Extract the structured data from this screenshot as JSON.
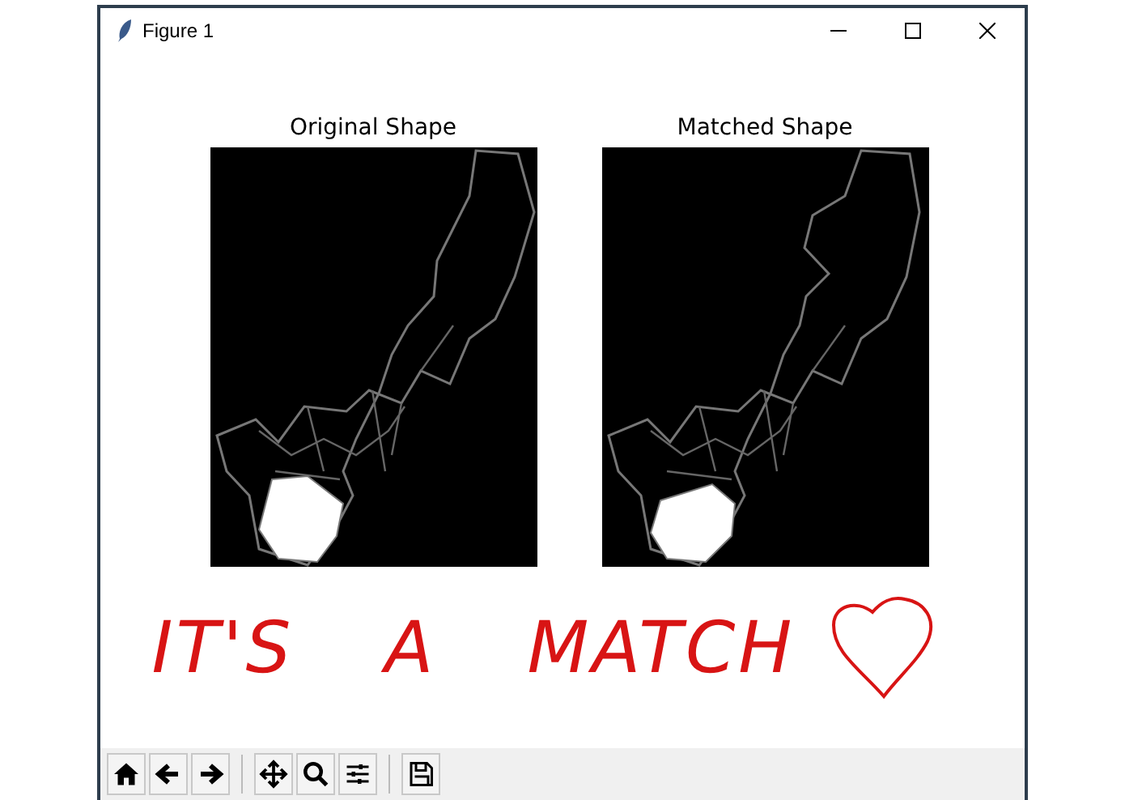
{
  "window": {
    "title": "Figure 1"
  },
  "plots": [
    {
      "title": "Original Shape"
    },
    {
      "title": "Matched Shape"
    }
  ],
  "annotation": {
    "text": "IT'S A MATCH"
  }
}
